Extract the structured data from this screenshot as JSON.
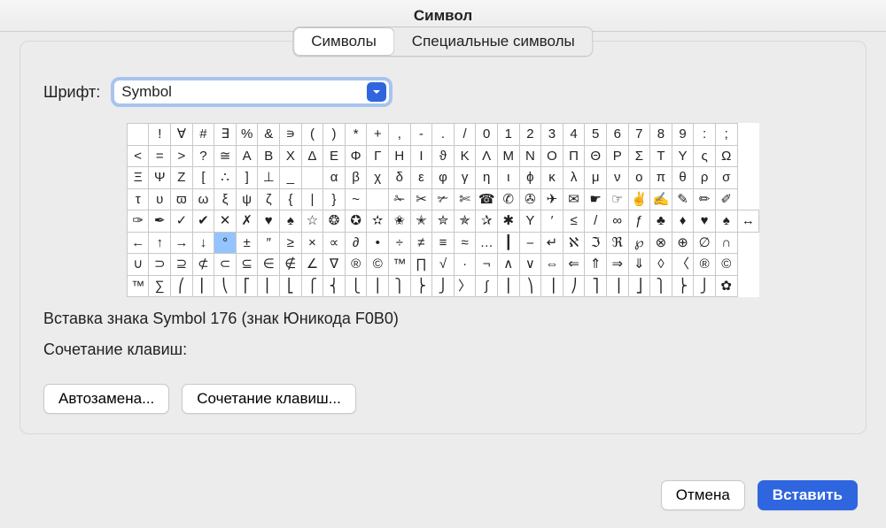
{
  "window": {
    "title": "Символ"
  },
  "tabs": {
    "symbols": "Символы",
    "special": "Специальные символы",
    "active": "symbols"
  },
  "font": {
    "label": "Шрифт:",
    "value": "Symbol"
  },
  "grid": {
    "rows": [
      [
        " ",
        "!",
        "∀",
        "#",
        "∃",
        "%",
        "&",
        "∍",
        "(",
        ")",
        "*",
        "+",
        ",",
        "-",
        ".",
        "/",
        "0",
        "1",
        "2",
        "3",
        "4",
        "5",
        "6",
        "7",
        "8",
        "9",
        ":",
        ";"
      ],
      [
        "<",
        "=",
        ">",
        "?",
        "≅",
        "A",
        "B",
        "X",
        "Δ",
        "E",
        "Φ",
        "Γ",
        "H",
        "I",
        "ϑ",
        "K",
        "Λ",
        "M",
        "N",
        "O",
        "Π",
        "Θ",
        "P",
        "Σ",
        "T",
        "Y",
        "ς",
        "Ω"
      ],
      [
        "Ξ",
        "Ψ",
        "Z",
        "[",
        "∴",
        "]",
        "⊥",
        "_",
        " ",
        "α",
        "β",
        "χ",
        "δ",
        "ε",
        "φ",
        "γ",
        "η",
        "ι",
        "ϕ",
        "κ",
        "λ",
        "μ",
        "ν",
        "ο",
        "π",
        "θ",
        "ρ",
        "σ"
      ],
      [
        "τ",
        "υ",
        "ϖ",
        "ω",
        "ξ",
        "ψ",
        "ζ",
        "{",
        "|",
        "}",
        "~",
        " ",
        "✁",
        "✂",
        "✃",
        "✄",
        "☎",
        "✆",
        "✇",
        "✈",
        "✉",
        "☛",
        "☞",
        "✌",
        "✍",
        "✎",
        "✏",
        "✐"
      ],
      [
        "✑",
        "✒",
        "✓",
        "✔",
        "✕",
        "✗",
        "♥",
        "♠",
        "☆",
        "❂",
        "✪",
        "✫",
        "✬",
        "✭",
        "✮",
        "✯",
        "✰",
        "✱",
        "Υ",
        "′",
        "≤",
        "/",
        "∞",
        "ƒ",
        "♣",
        "♦",
        "♥",
        "♠",
        "↔"
      ],
      [
        "←",
        "↑",
        "→",
        "↓",
        "°",
        "±",
        "″",
        "≥",
        "×",
        "∝",
        "∂",
        "•",
        "÷",
        "≠",
        "≡",
        "≈",
        "…",
        "┃",
        "⎯",
        "↵",
        "ℵ",
        "ℑ",
        "ℜ",
        "℘",
        "⊗",
        "⊕",
        "∅",
        "∩"
      ],
      [
        "∪",
        "⊃",
        "⊇",
        "⊄",
        "⊂",
        "⊆",
        "∈",
        "∉",
        "∠",
        "∇",
        "®",
        "©",
        "™",
        "∏",
        "√",
        "·",
        "¬",
        "∧",
        "∨",
        "⇔",
        "⇐",
        "⇑",
        "⇒",
        "⇓",
        "◊",
        "〈",
        "®",
        "©"
      ],
      [
        "™",
        "∑",
        "⎛",
        "⎜",
        "⎝",
        "⎡",
        "⎢",
        "⎣",
        "⎧",
        "⎨",
        "⎩",
        "⎪",
        "⎫",
        "⎬",
        "⎭",
        "〉",
        "∫",
        "⎮",
        "⎞",
        "⎟",
        "⎠",
        "⎤",
        "⎥",
        "⎦",
        "⎫",
        "⎬",
        "⎭",
        "✿"
      ]
    ],
    "selected": {
      "row": 5,
      "col": 4
    }
  },
  "info": "Вставка знака Symbol 176 (знак Юникода F0B0)",
  "shortcut_label": "Сочетание клавиш:",
  "buttons": {
    "autocorrect": "Автозамена...",
    "shortcut": "Сочетание клавиш...",
    "cancel": "Отмена",
    "insert": "Вставить"
  }
}
